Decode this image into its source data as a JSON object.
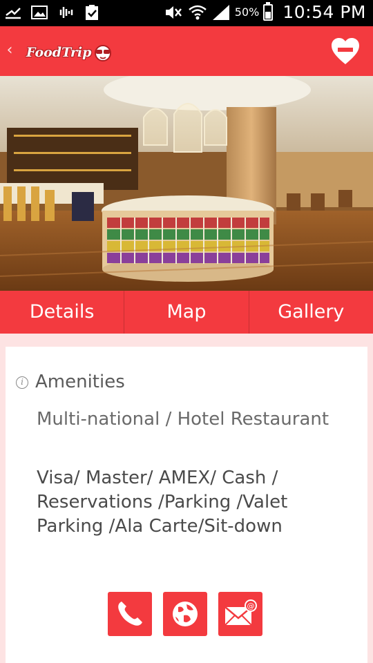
{
  "status_bar": {
    "battery_percent": "50%",
    "time": "10:54 PM"
  },
  "app_bar": {
    "back_icon": "chevron-left-icon",
    "logo_text": "FoodTrip",
    "favorite_icon": "heart-minus-icon"
  },
  "tabs": [
    {
      "label": "Details",
      "active": true
    },
    {
      "label": "Map",
      "active": false
    },
    {
      "label": "Gallery",
      "active": false
    }
  ],
  "details": {
    "section_title": "Amenities",
    "cuisine": "Multi-national / Hotel Restaurant",
    "amenities": "Visa/ Master/ AMEX/ Cash / Reservations /Parking /Valet Parking /Ala Carte/Sit-down"
  },
  "actions": [
    {
      "name": "call-button",
      "icon": "phone-icon"
    },
    {
      "name": "website-button",
      "icon": "globe-icon"
    },
    {
      "name": "email-button",
      "icon": "email-icon"
    }
  ],
  "colors": {
    "brand": "#f33a3f",
    "content_bg": "#fde3e3"
  }
}
